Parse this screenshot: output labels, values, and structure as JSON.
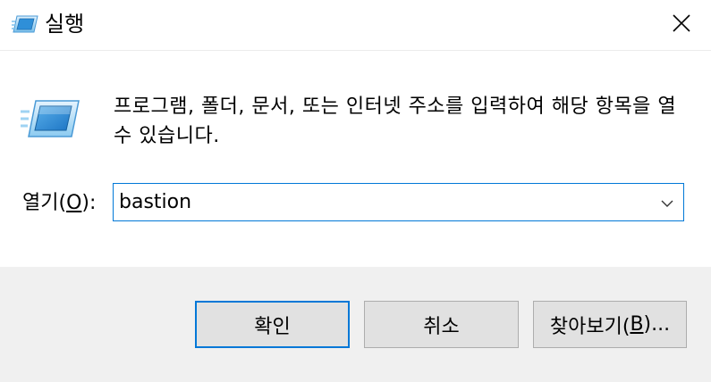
{
  "window": {
    "title": "실행",
    "title_icon": "run-icon",
    "close_icon": "close-icon"
  },
  "content": {
    "description": "프로그램, 폴더, 문서, 또는 인터넷 주소를 입력하여 해당 항목을 열 수 있습니다.",
    "open_label_prefix": "열기(",
    "open_label_mnemonic": "O",
    "open_label_suffix": "):",
    "open_value": "bastion",
    "dropdown_icon": "chevron-down-icon"
  },
  "buttons": {
    "ok_label": "확인",
    "cancel_label": "취소",
    "browse_prefix": "찾아보기(",
    "browse_mnemonic": "B",
    "browse_suffix": ")..."
  },
  "colors": {
    "accent": "#0078d7",
    "footer_bg": "#f0f0f0",
    "button_bg": "#e1e1e1",
    "button_border": "#adadad"
  }
}
